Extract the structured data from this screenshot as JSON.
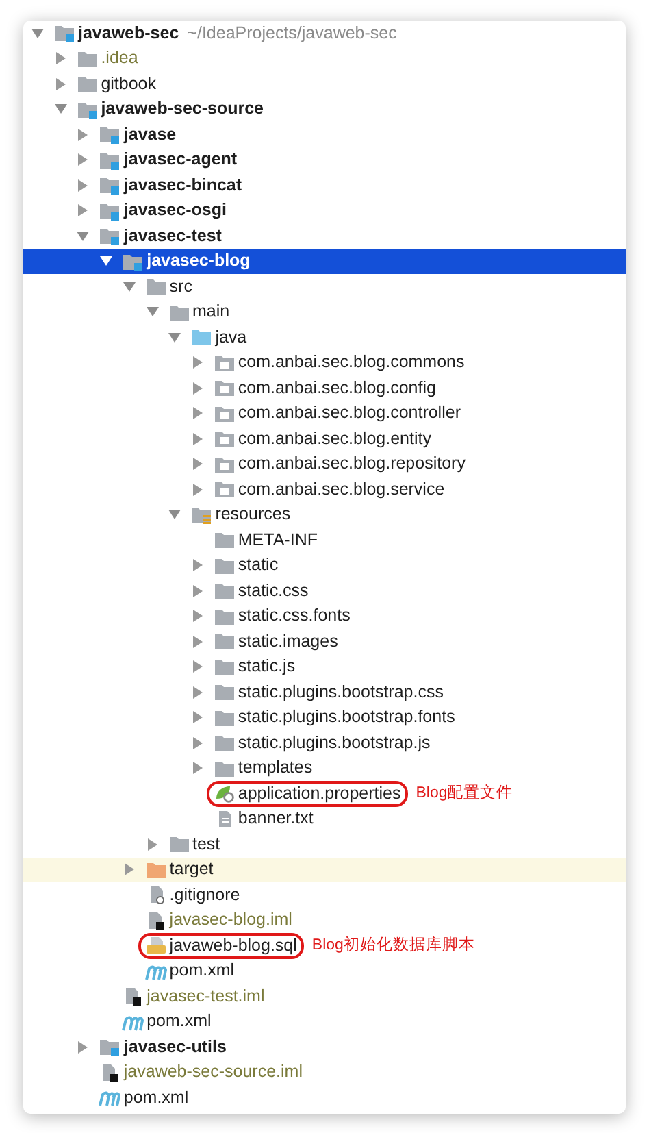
{
  "project_tree": [
    {
      "label": "javaweb-sec",
      "path": "~/IdeaProjects/javaweb-sec",
      "kind": "module",
      "expanded": true,
      "selected": false,
      "children": [
        {
          "label": ".idea",
          "kind": "folder",
          "expanded": false,
          "selected": false,
          "dimmed": true
        },
        {
          "label": "gitbook",
          "kind": "folder",
          "expanded": false,
          "selected": false
        },
        {
          "label": "javaweb-sec-source",
          "kind": "module",
          "expanded": true,
          "selected": false,
          "children": [
            {
              "label": "javase",
              "kind": "module",
              "expanded": false,
              "selected": false
            },
            {
              "label": "javasec-agent",
              "kind": "module",
              "expanded": false,
              "selected": false
            },
            {
              "label": "javasec-bincat",
              "kind": "module",
              "expanded": false,
              "selected": false
            },
            {
              "label": "javasec-osgi",
              "kind": "module",
              "expanded": false,
              "selected": false
            },
            {
              "label": "javasec-test",
              "kind": "module",
              "expanded": true,
              "selected": false,
              "children": [
                {
                  "label": "javasec-blog",
                  "kind": "module",
                  "expanded": true,
                  "selected": true,
                  "children": [
                    {
                      "label": "src",
                      "kind": "folder",
                      "expanded": true,
                      "selected": false,
                      "children": [
                        {
                          "label": "main",
                          "kind": "folder",
                          "expanded": true,
                          "selected": false,
                          "children": [
                            {
                              "label": "java",
                              "kind": "source",
                              "expanded": true,
                              "selected": false,
                              "children": [
                                {
                                  "label": "com.anbai.sec.blog.commons",
                                  "kind": "package",
                                  "expanded": false,
                                  "selected": false
                                },
                                {
                                  "label": "com.anbai.sec.blog.config",
                                  "kind": "package",
                                  "expanded": false,
                                  "selected": false
                                },
                                {
                                  "label": "com.anbai.sec.blog.controller",
                                  "kind": "package",
                                  "expanded": false,
                                  "selected": false
                                },
                                {
                                  "label": "com.anbai.sec.blog.entity",
                                  "kind": "package",
                                  "expanded": false,
                                  "selected": false
                                },
                                {
                                  "label": "com.anbai.sec.blog.repository",
                                  "kind": "package",
                                  "expanded": false,
                                  "selected": false
                                },
                                {
                                  "label": "com.anbai.sec.blog.service",
                                  "kind": "package",
                                  "expanded": false,
                                  "selected": false
                                }
                              ]
                            },
                            {
                              "label": "resources",
                              "kind": "resources",
                              "expanded": true,
                              "selected": false,
                              "children": [
                                {
                                  "label": "META-INF",
                                  "kind": "folder",
                                  "selected": false
                                },
                                {
                                  "label": "static",
                                  "kind": "folder",
                                  "expanded": false,
                                  "selected": false
                                },
                                {
                                  "label": "static.css",
                                  "kind": "folder",
                                  "expanded": false,
                                  "selected": false
                                },
                                {
                                  "label": "static.css.fonts",
                                  "kind": "folder",
                                  "expanded": false,
                                  "selected": false
                                },
                                {
                                  "label": "static.images",
                                  "kind": "folder",
                                  "expanded": false,
                                  "selected": false
                                },
                                {
                                  "label": "static.js",
                                  "kind": "folder",
                                  "expanded": false,
                                  "selected": false
                                },
                                {
                                  "label": "static.plugins.bootstrap.css",
                                  "kind": "folder",
                                  "expanded": false,
                                  "selected": false
                                },
                                {
                                  "label": "static.plugins.bootstrap.fonts",
                                  "kind": "folder",
                                  "expanded": false,
                                  "selected": false
                                },
                                {
                                  "label": "static.plugins.bootstrap.js",
                                  "kind": "folder",
                                  "expanded": false,
                                  "selected": false
                                },
                                {
                                  "label": "templates",
                                  "kind": "folder",
                                  "expanded": false,
                                  "selected": false
                                },
                                {
                                  "label": "application.properties",
                                  "kind": "properties",
                                  "selected": false,
                                  "circled": true,
                                  "note": "Blog配置文件"
                                },
                                {
                                  "label": "banner.txt",
                                  "kind": "text",
                                  "selected": false
                                }
                              ]
                            }
                          ]
                        },
                        {
                          "label": "test",
                          "kind": "folder",
                          "expanded": false,
                          "selected": false
                        }
                      ]
                    },
                    {
                      "label": "target",
                      "kind": "excluded",
                      "expanded": false,
                      "selected": false,
                      "highlighted": true
                    },
                    {
                      "label": ".gitignore",
                      "kind": "gitignore",
                      "selected": false
                    },
                    {
                      "label": "javasec-blog.iml",
                      "kind": "iml",
                      "selected": false,
                      "dimmed": true
                    },
                    {
                      "label": "javaweb-blog.sql",
                      "kind": "sql",
                      "selected": false,
                      "circled": true,
                      "note": "Blog初始化数据库脚本"
                    },
                    {
                      "label": "pom.xml",
                      "kind": "maven",
                      "selected": false
                    }
                  ]
                },
                {
                  "label": "javasec-test.iml",
                  "kind": "iml",
                  "selected": false,
                  "dimmed": true
                },
                {
                  "label": "pom.xml",
                  "kind": "maven",
                  "selected": false
                }
              ]
            },
            {
              "label": "javasec-utils",
              "kind": "module",
              "expanded": false,
              "selected": false
            },
            {
              "label": "javaweb-sec-source.iml",
              "kind": "iml",
              "selected": false,
              "dimmed": true
            },
            {
              "label": "pom.xml",
              "kind": "maven",
              "selected": false
            }
          ]
        }
      ]
    }
  ]
}
